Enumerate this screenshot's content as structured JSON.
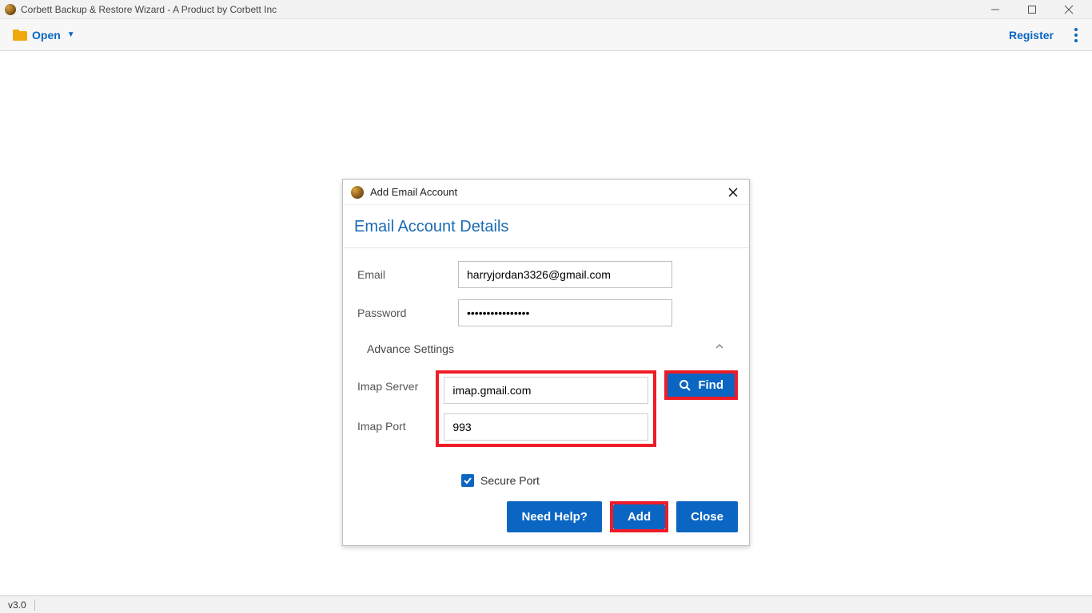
{
  "title": "Corbett Backup & Restore Wizard - A Product by Corbett Inc",
  "toolbar": {
    "open": "Open",
    "register": "Register"
  },
  "dialog": {
    "title": "Add Email Account",
    "section": "Email Account Details",
    "labels": {
      "email": "Email",
      "password": "Password",
      "advance": "Advance Settings",
      "imap_server": "Imap Server",
      "imap_port": "Imap Port",
      "secure": "Secure Port"
    },
    "values": {
      "email": "harryjordan3326@gmail.com",
      "password": "••••••••••••••••",
      "imap_server": "imap.gmail.com",
      "imap_port": "993"
    },
    "buttons": {
      "find": "Find",
      "need_help": "Need Help?",
      "add": "Add",
      "close": "Close"
    }
  },
  "status": {
    "version": "v3.0"
  }
}
